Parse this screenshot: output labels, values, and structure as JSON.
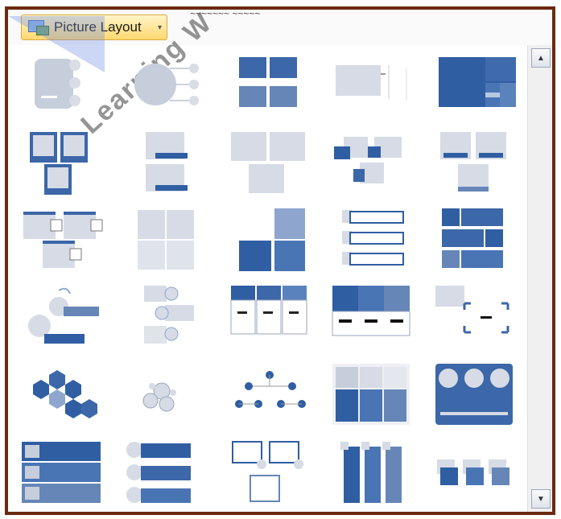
{
  "toolbar": {
    "layout_label": "Picture Layout",
    "cutoff_text": "~~~~~~~  ~~~~~"
  },
  "watermark": {
    "text": "Learning W"
  },
  "gallery": {
    "items": [
      "bending-picture-accent-list",
      "circular-picture-callout",
      "picture-grid",
      "picture-caption-list",
      "picture-accent-blocks",
      "titled-picture-blocks",
      "captioned-pictures",
      "snapshot-picture-list",
      "picture-accent-process",
      "alternating-picture-blocks",
      "bending-picture-blocks",
      "picture-strips",
      "ascending-picture-accent",
      "framed-text-picture",
      "picture-lineup",
      "spiral-picture",
      "accented-picture",
      "titled-matrix",
      "title-picture-lineup",
      "bending-picture-caption",
      "hexagon-cluster",
      "circle-picture-hierarchy",
      "picture-organization-chart",
      "vertical-picture-accent",
      "horizontal-picture-list",
      "vertical-picture-list",
      "picture-accent-list",
      "continuous-picture-list",
      "vertical-title-pictures",
      "picture-frame-process"
    ]
  },
  "scroll": {
    "up_glyph": "▲",
    "down_glyph": "▼"
  }
}
